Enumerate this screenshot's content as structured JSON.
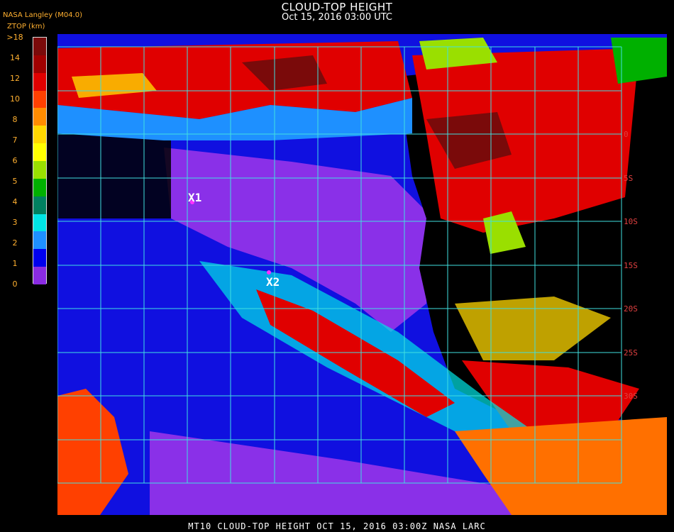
{
  "header": {
    "title": "CLOUD-TOP HEIGHT",
    "subtitle": "Oct 15, 2016 03:00 UTC",
    "source": "NASA Langley (M04.0)",
    "units": "ZTOP (km)"
  },
  "legend": {
    "ticks": [
      ">18",
      "14",
      "12",
      "10",
      "8",
      "7",
      "6",
      "5",
      "4",
      "3",
      "2",
      "1",
      "0"
    ],
    "colors": [
      "#7a0a0a",
      "#a00000",
      "#e00000",
      "#ff4000",
      "#ff8c00",
      "#ffd700",
      "#ffff00",
      "#9adf00",
      "#00b000",
      "#008060",
      "#00e5e5",
      "#1e90ff",
      "#0000ee",
      "#8a2be2"
    ]
  },
  "map": {
    "markers": [
      {
        "label": "X1",
        "color": "#ff30ff"
      },
      {
        "label": "X2",
        "color": "#ff30ff"
      }
    ],
    "lat_labels": [
      "0",
      "5S",
      "10S",
      "15S",
      "20S",
      "25S",
      "30S"
    ],
    "grid_color": "#40e0e0",
    "region_colors": {
      "ocean_low": "#1010e0",
      "clear_low": "#8a30e8",
      "high_cloud": "#e00000",
      "mid_cloud": "#1e90ff",
      "land_clear": "#000000",
      "sc_orange": "#ff7000"
    }
  },
  "footer": {
    "text": "MT10  CLOUD-TOP HEIGHT   OCT 15, 2016 03:00Z   NASA LARC"
  }
}
